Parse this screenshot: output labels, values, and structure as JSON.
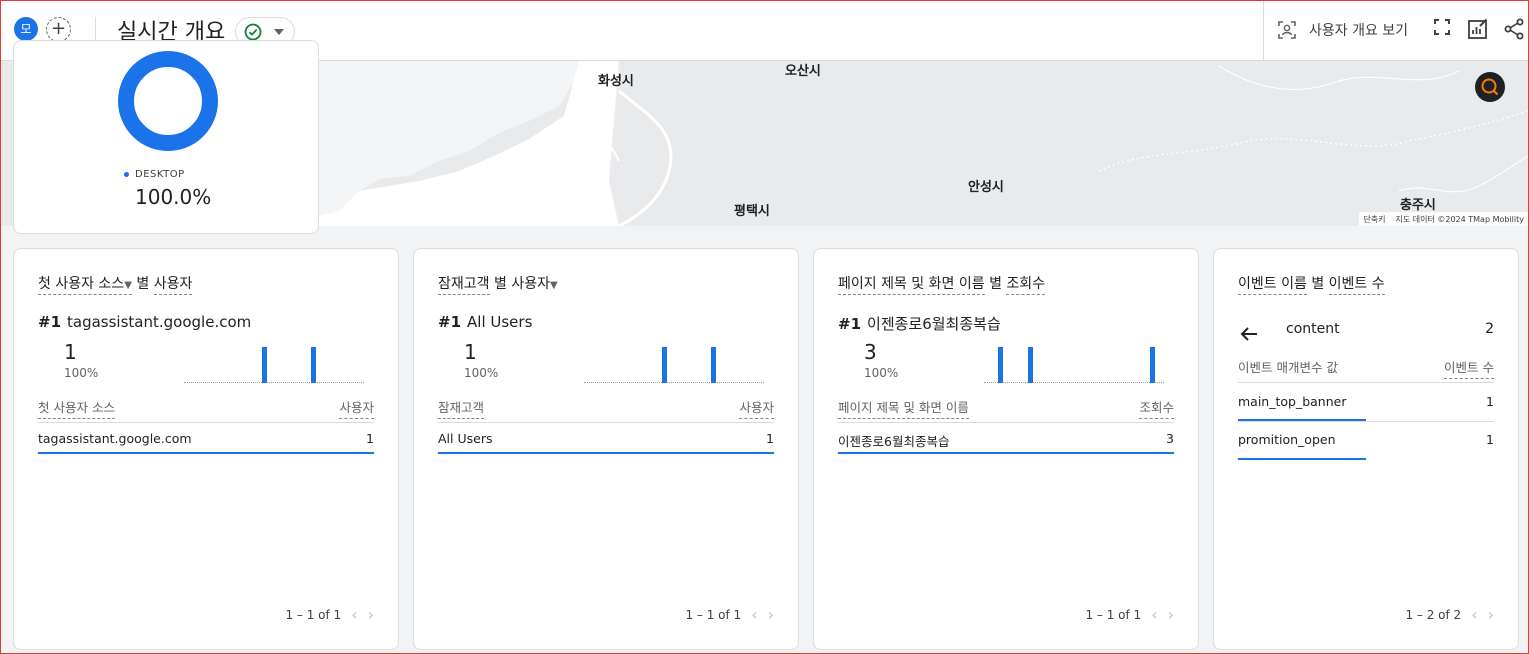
{
  "header": {
    "avatar": "모",
    "add_label": "+",
    "title": "실시간 개요",
    "user_view_label": "사용자 개요 보기"
  },
  "donut": {
    "legend_label": "DESKTOP",
    "value": "100.0%",
    "fraction": 1.0,
    "color": "#1a73e8"
  },
  "map": {
    "cities": [
      "화성시",
      "오산시",
      "안성시",
      "평택시",
      "충주시"
    ],
    "attribution_shortcut": "단축키",
    "attribution_data": "지도 데이터 ©2024 TMap Mobility"
  },
  "cards": [
    {
      "title_parts": [
        "첫 사용자 소스",
        "별",
        "사용자"
      ],
      "rank": "#1",
      "rank_label": "tagassistant.google.com",
      "value": "1",
      "pct": "100%",
      "spark": [
        0,
        0,
        0,
        0,
        0,
        0,
        0,
        0,
        0,
        0,
        0,
        0,
        0,
        1,
        0,
        0,
        0,
        0,
        0,
        0,
        0,
        1,
        0,
        0,
        0,
        0,
        0,
        0,
        0,
        0
      ],
      "col_dim": "첫 사용자 소스",
      "col_metric": "사용자",
      "rows": [
        {
          "label": "tagassistant.google.com",
          "value": "1"
        }
      ],
      "pager": "1 – 1 of 1"
    },
    {
      "title_parts": [
        "잠재고객",
        "별 사용자"
      ],
      "rank": "#1",
      "rank_label": "All Users",
      "value": "1",
      "pct": "100%",
      "spark": [
        0,
        0,
        0,
        0,
        0,
        0,
        0,
        0,
        0,
        0,
        0,
        0,
        0,
        1,
        0,
        0,
        0,
        0,
        0,
        0,
        0,
        1,
        0,
        0,
        0,
        0,
        0,
        0,
        0,
        0
      ],
      "col_dim": "잠재고객",
      "col_metric": "사용자",
      "rows": [
        {
          "label": "All Users",
          "value": "1"
        }
      ],
      "pager": "1 – 1 of 1"
    },
    {
      "title_parts": [
        "페이지 제목 및 화면 이름",
        "별",
        "조회수"
      ],
      "rank": "#1",
      "rank_label": "이젠종로6월최종복습",
      "value": "3",
      "pct": "100%",
      "spark": [
        0,
        0,
        0,
        0,
        0,
        0,
        0,
        0,
        0,
        0,
        0,
        0,
        0,
        0,
        0,
        0,
        0,
        0,
        0,
        0,
        0,
        0,
        0,
        0,
        0,
        0,
        0,
        0,
        0,
        0
      ],
      "spark_marks": [
        0.08,
        0.25,
        0.95
      ],
      "col_dim": "페이지 제목 및 화면 이름",
      "col_metric": "조회수",
      "rows": [
        {
          "label": "이젠종로6월최종복습",
          "value": "3"
        }
      ],
      "pager": "1 – 1 of 1"
    }
  ],
  "event_card": {
    "title_parts": [
      "이벤트 이름",
      "별",
      "이벤트 수"
    ],
    "event_name": "content",
    "event_count": "2",
    "col_param": "이벤트 매개변수 값",
    "col_metric": "이벤트 수",
    "rows": [
      {
        "label": "main_top_banner",
        "value": "1"
      },
      {
        "label": "promition_open",
        "value": "1"
      }
    ],
    "pager": "1 – 2 of 2"
  }
}
